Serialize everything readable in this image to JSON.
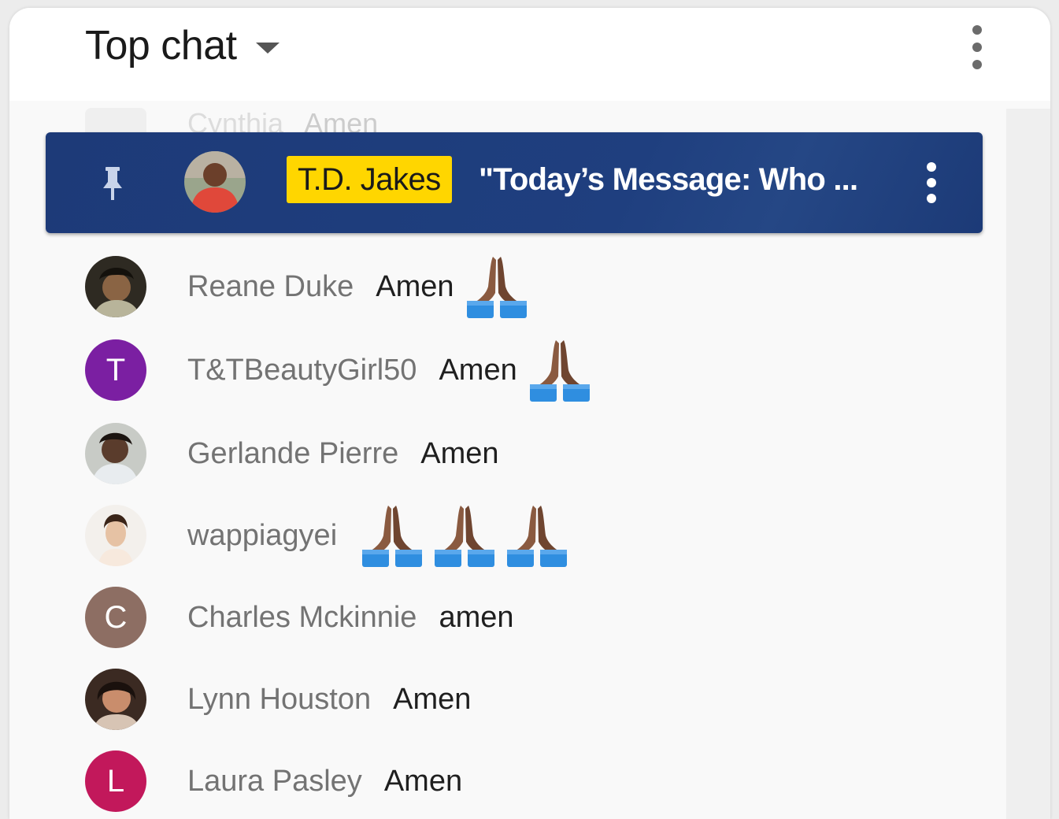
{
  "header": {
    "title": "Top chat"
  },
  "ghost_message": {
    "author": "Cynthia",
    "text": "Amen"
  },
  "pinned": {
    "author": "T.D. Jakes",
    "message": "\"Today’s Message: Who ..."
  },
  "messages": [
    {
      "author": "Reane Duke",
      "text": "Amen",
      "initial": "",
      "emoji": "praying-hands",
      "emoji_count": 1
    },
    {
      "author": "T&TBeautyGirl50",
      "text": "Amen",
      "initial": "T",
      "avatar_color": "#7b1fa2",
      "emoji": "praying-hands",
      "emoji_count": 1
    },
    {
      "author": "Gerlande Pierre",
      "text": "Amen",
      "initial": "",
      "emoji_count": 0
    },
    {
      "author": "wappiagyei",
      "text": "",
      "initial": "",
      "emoji": "praying-hands",
      "emoji_count": 3
    },
    {
      "author": "Charles Mckinnie",
      "text": "amen",
      "initial": "C",
      "avatar_color": "#8d6e63",
      "emoji_count": 0
    },
    {
      "author": "Lynn Houston",
      "text": "Amen",
      "initial": "",
      "emoji_count": 0
    },
    {
      "author": "Laura Pasley",
      "text": "Amen",
      "initial": "L",
      "avatar_color": "#c2185b",
      "emoji_count": 0
    }
  ],
  "colors": {
    "pinned_background": "#1f3f7f",
    "owner_badge": "#ffd600",
    "scrollbar_track": "#efefef"
  }
}
